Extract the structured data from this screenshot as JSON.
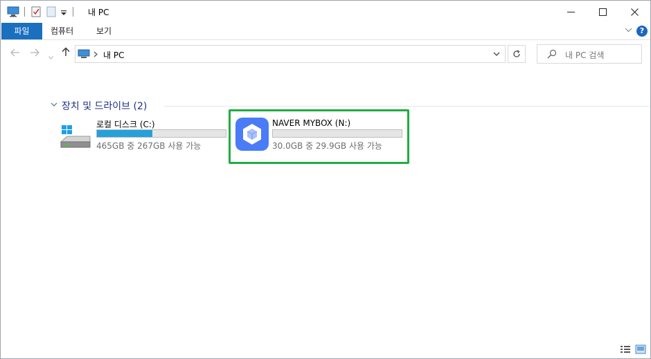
{
  "window": {
    "title": "내 PC"
  },
  "ribbon": {
    "tabs": [
      {
        "label": "파일"
      },
      {
        "label": "컴퓨터"
      },
      {
        "label": "보기"
      }
    ],
    "help_label": "?"
  },
  "address": {
    "path_label": "내 PC"
  },
  "search": {
    "placeholder": "내 PC 검색"
  },
  "section": {
    "title": "장치 및 드라이브 (2)"
  },
  "drives": [
    {
      "name": "로컬 디스크 (C:)",
      "capacity": "465GB 중 267GB 사용 가능",
      "used_fraction": 0.43
    },
    {
      "name": "NAVER MYBOX (N:)",
      "capacity": "30.0GB 중 29.9GB 사용 가능",
      "used_fraction": 0.0
    }
  ],
  "colors": {
    "file_tab": "#1a6fbf",
    "progress_fill": "#26a0da",
    "highlight_box": "#1fad3f",
    "mybox_icon": "#4a7cf7"
  }
}
